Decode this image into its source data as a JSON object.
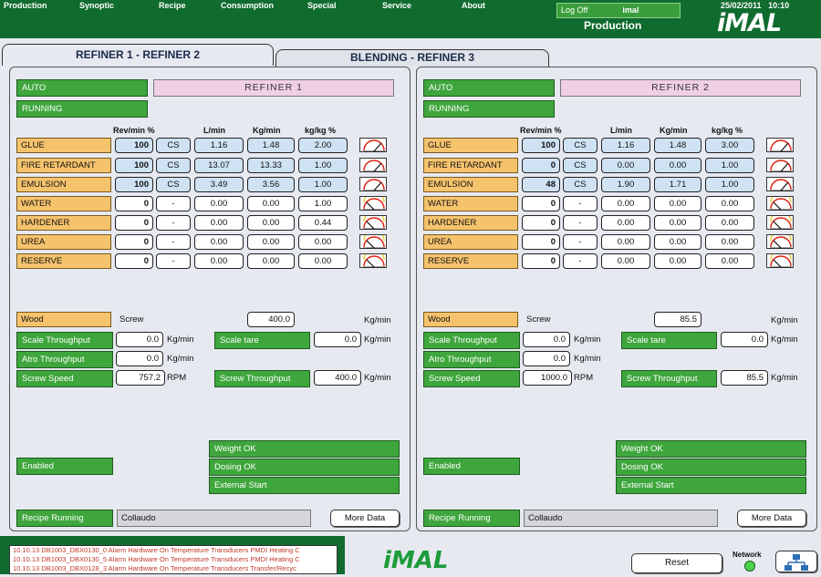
{
  "menu": [
    "Production",
    "Synoptic",
    "Recipe",
    "Consumption",
    "Special",
    "Service",
    "About"
  ],
  "header": {
    "logoff": "Log Off",
    "user": "imal",
    "title": "Production",
    "date": "25/02/2011",
    "time": "10:10",
    "logo": "iMAL"
  },
  "tabs": [
    "REFINER 1 - REFINER 2",
    "BLENDING - REFINER 3"
  ],
  "column_headers": [
    "Rev/min %",
    "L/min",
    "Kg/min",
    "kg/kg %"
  ],
  "panels": [
    {
      "mode": "AUTO",
      "name": "REFINER 1",
      "state": "RUNNING",
      "rows": [
        {
          "label": "GLUE",
          "rev": "100",
          "mode": "CS",
          "lmin": "1.16",
          "kgmin": "1.48",
          "kgkg": "2.00"
        },
        {
          "label": "FIRE RETARDANT",
          "rev": "100",
          "mode": "CS",
          "lmin": "13.07",
          "kgmin": "13.33",
          "kgkg": "1.00"
        },
        {
          "label": "EMULSION",
          "rev": "100",
          "mode": "CS",
          "lmin": "3.49",
          "kgmin": "3.56",
          "kgkg": "1.00"
        },
        {
          "label": "WATER",
          "rev": "0",
          "mode": "-",
          "lmin": "0.00",
          "kgmin": "0.00",
          "kgkg": "1.00"
        },
        {
          "label": "HARDENER",
          "rev": "0",
          "mode": "-",
          "lmin": "0.00",
          "kgmin": "0.00",
          "kgkg": "0.44"
        },
        {
          "label": "UREA",
          "rev": "0",
          "mode": "-",
          "lmin": "0.00",
          "kgmin": "0.00",
          "kgkg": "0.00"
        },
        {
          "label": "RESERVE",
          "rev": "0",
          "mode": "-",
          "lmin": "0.00",
          "kgmin": "0.00",
          "kgkg": "0.00"
        }
      ],
      "wood": {
        "label": "Wood",
        "type": "Screw",
        "value": "400.0",
        "unit": "Kg/min"
      },
      "scale_throughput": {
        "label": "Scale Throughput",
        "value": "0.0",
        "unit": "Kg/min"
      },
      "scale_tare": {
        "label": "Scale tare",
        "value": "0.0",
        "unit": "Kg/min"
      },
      "atro_throughput": {
        "label": "Atro Throughput",
        "value": "0.0",
        "unit": "Kg/min"
      },
      "screw_speed": {
        "label": "Screw Speed",
        "value": "757.2",
        "unit": "RPM"
      },
      "screw_throughput": {
        "label": "Screw Throughput",
        "value": "400.0",
        "unit": "Kg/min"
      },
      "weight_ok": "Weight OK",
      "enabled": "Enabled",
      "dosing_ok": "Dosing OK",
      "external_start": "External Start",
      "recipe_running": "Recipe Running",
      "recipe_name": "Collaudo",
      "more_data": "More Data"
    },
    {
      "mode": "AUTO",
      "name": "REFINER 2",
      "state": "RUNNING",
      "rows": [
        {
          "label": "GLUE",
          "rev": "100",
          "mode": "CS",
          "lmin": "1.16",
          "kgmin": "1.48",
          "kgkg": "3.00"
        },
        {
          "label": "FIRE RETARDANT",
          "rev": "0",
          "mode": "CS",
          "lmin": "0.00",
          "kgmin": "0.00",
          "kgkg": "1.00"
        },
        {
          "label": "EMULSION",
          "rev": "48",
          "mode": "CS",
          "lmin": "1.90",
          "kgmin": "1.71",
          "kgkg": "1.00"
        },
        {
          "label": "WATER",
          "rev": "0",
          "mode": "-",
          "lmin": "0.00",
          "kgmin": "0.00",
          "kgkg": "0.00"
        },
        {
          "label": "HARDENER",
          "rev": "0",
          "mode": "-",
          "lmin": "0.00",
          "kgmin": "0.00",
          "kgkg": "0.00"
        },
        {
          "label": "UREA",
          "rev": "0",
          "mode": "-",
          "lmin": "0.00",
          "kgmin": "0.00",
          "kgkg": "0.00"
        },
        {
          "label": "RESERVE",
          "rev": "0",
          "mode": "-",
          "lmin": "0.00",
          "kgmin": "0.00",
          "kgkg": "0.00"
        }
      ],
      "wood": {
        "label": "Wood",
        "type": "Screw",
        "value": "85.5",
        "unit": "Kg/min"
      },
      "scale_throughput": {
        "label": "Scale Throughput",
        "value": "0.0",
        "unit": "Kg/min"
      },
      "scale_tare": {
        "label": "Scale tare",
        "value": "0.0",
        "unit": "Kg/min"
      },
      "atro_throughput": {
        "label": "Atro Throughput",
        "value": "0.0",
        "unit": "Kg/min"
      },
      "screw_speed": {
        "label": "Screw Speed",
        "value": "1000.0",
        "unit": "RPM"
      },
      "screw_throughput": {
        "label": "Screw Throughput",
        "value": "85.5",
        "unit": "Kg/min"
      },
      "weight_ok": "Weight OK",
      "enabled": "Enabled",
      "dosing_ok": "Dosing OK",
      "external_start": "External Start",
      "recipe_running": "Recipe Running",
      "recipe_name": "Collaudo",
      "more_data": "More Data"
    }
  ],
  "alarms": [
    "10.10.13    DB1003_DBX0130_0    Alarm Hardware On Temperature Transducers PMDI Heating C",
    "10.10.13    DB1003_DBX0130_5    Alarm Hardware On Temperature Transducers PMDI Heating C",
    "10.10.13    DB1003_DBX0128_3    Alarm Hardware On Temperature Transducers Transfer/Recyc"
  ],
  "footer": {
    "logo": "iMAL",
    "reset": "Reset",
    "network": "Network"
  },
  "colors": {
    "brand_green": "#0f6b2e",
    "button_green": "#3ea63c",
    "label_orange": "#f6c36d",
    "value_blue": "#cfe2f4",
    "title_pink": "#f0cfe6",
    "alarm_red": "#c0392b"
  }
}
